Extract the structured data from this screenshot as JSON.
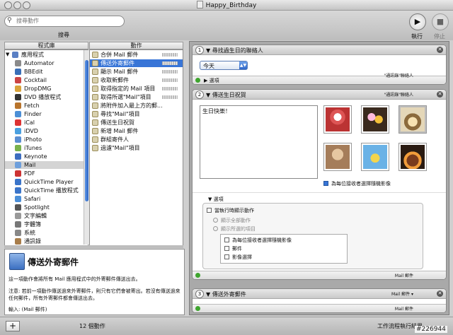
{
  "window": {
    "title": "Happy_Birthday"
  },
  "toolbar": {
    "search_placeholder": "搜尋動作",
    "search_label": "搜尋",
    "run_label": "執行",
    "stop_label": "停止"
  },
  "library": {
    "header": "程式庫",
    "items": [
      {
        "label": "應用程式",
        "color": "#5a7fc4"
      },
      {
        "label": "Automator",
        "color": "#8a8a8a"
      },
      {
        "label": "BBEdit",
        "color": "#3a6fb8"
      },
      {
        "label": "Cocktail",
        "color": "#c44"
      },
      {
        "label": "DropDMG",
        "color": "#d9a33a"
      },
      {
        "label": "DVD 播放程式",
        "color": "#333"
      },
      {
        "label": "Fetch",
        "color": "#b8742c"
      },
      {
        "label": "Finder",
        "color": "#4c8fd6"
      },
      {
        "label": "iCal",
        "color": "#d33"
      },
      {
        "label": "iDVD",
        "color": "#4aa0e0"
      },
      {
        "label": "iPhoto",
        "color": "#5a8ed2"
      },
      {
        "label": "iTunes",
        "color": "#79b14c"
      },
      {
        "label": "Keynote",
        "color": "#3d6dc0"
      },
      {
        "label": "Mail",
        "color": "#6fa0dc"
      },
      {
        "label": "PDF",
        "color": "#c33"
      },
      {
        "label": "QuickTime Player",
        "color": "#3a74c9"
      },
      {
        "label": "QuickTime 播放程式",
        "color": "#3a74c9"
      },
      {
        "label": "Safari",
        "color": "#4b8fd8"
      },
      {
        "label": "Spotlight",
        "color": "#555"
      },
      {
        "label": "文字編輯",
        "color": "#999"
      },
      {
        "label": "字體簿",
        "color": "#777"
      },
      {
        "label": "系統",
        "color": "#888"
      },
      {
        "label": "通訊錄",
        "color": "#a87d4a"
      }
    ]
  },
  "actions": {
    "header": "動作",
    "items": [
      "合併 Mail 郵件",
      "傳送外寄郵件",
      "顯示 Mail 郵件",
      "收取新郵件",
      "取得指定的 Mail 項目",
      "取得所選\"Mail\"項目",
      "將附件加入最上方的郵...",
      "尋找\"Mail\"項目",
      "傳送生日祝賀",
      "新增 Mail 郵件",
      "群組寄件人",
      "過濾\"Mail\"項目"
    ]
  },
  "description": {
    "title": "傳送外寄郵件",
    "body1": "這一項動作會將所有 Mail 應用程式中的外寄郵件傳送出去。",
    "body2": "注意: 若前一項動作傳送過來外寄郵件，則只有它們會被寄出。若沒有傳送過來任何郵件，所有外寄郵件都會傳送出去。",
    "input": "輸入: (Mail 郵件)"
  },
  "workflow": {
    "card1": {
      "number": "1",
      "title": "尋找過生日的聯絡人",
      "select_value": "今天",
      "options_label": "選項",
      "output": "\"通訊錄\"聯絡人"
    },
    "card2": {
      "number": "2",
      "title": "傳送生日祝賀",
      "message": "生日快樂！",
      "random_image_label": "為每位接收者選擇隨機影像",
      "options_label": "選項",
      "show_when_run": "當執行時顯示動作",
      "show_all": "顯示全部動作",
      "show_selected": "顯示所選的項目",
      "sub_items": [
        "為每位接收者選擇隨機影像",
        "郵件",
        "影像選擇"
      ],
      "input_tag": "\"通訊錄\"聯絡人",
      "output": "Mail 郵件"
    },
    "card3": {
      "number": "3",
      "title": "傳送外寄郵件",
      "input_tag": "Mail 郵件",
      "output": "Mail 郵件"
    }
  },
  "status": {
    "count": "12 個動作",
    "right": "工作流程執行結果",
    "watermark": "#226944"
  }
}
